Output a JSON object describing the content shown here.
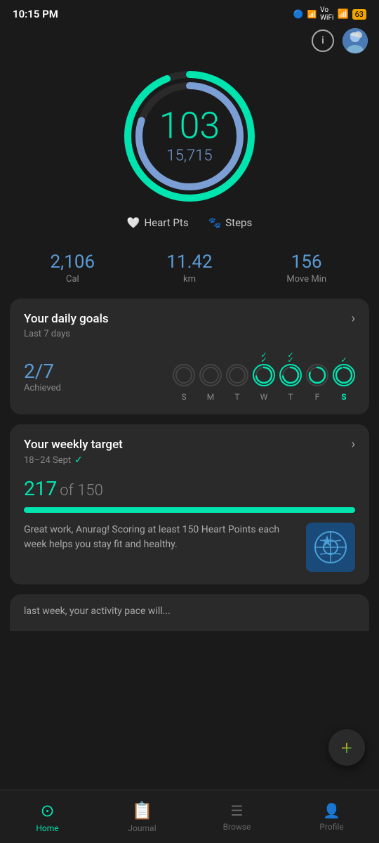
{
  "statusBar": {
    "time": "10:15 PM",
    "icons": "🔵 📶 Vo WiFi 🔋"
  },
  "header": {
    "info_label": "i",
    "avatar_emoji": "👤"
  },
  "ring": {
    "main_value": "103",
    "sub_value": "15,715",
    "outer_color": "#00e5b0",
    "inner_color": "#7b9fd4"
  },
  "legend": {
    "heart_pts_label": "Heart Pts",
    "steps_label": "Steps"
  },
  "stats": [
    {
      "value": "2,106",
      "label": "Cal"
    },
    {
      "value": "11.42",
      "label": "km"
    },
    {
      "value": "156",
      "label": "Move Min"
    }
  ],
  "daily_goals": {
    "title": "Your daily goals",
    "subtitle": "Last 7 days",
    "achieved_fraction": "2/7",
    "achieved_label": "Achieved",
    "days": [
      "S",
      "M",
      "T",
      "W",
      "T",
      "F",
      "S"
    ],
    "achieved_days": [
      3,
      4,
      5,
      6
    ]
  },
  "weekly_target": {
    "title": "Your weekly target",
    "date_range": "18–24 Sept",
    "achieved_value": "217",
    "target_value": "150",
    "of_label": "of",
    "progress_percent": 100,
    "description": "Great work, Anurag! Scoring at least 150 Heart Points each week helps you stay fit and healthy."
  },
  "bottom_teaser": {
    "text": "last week, your activity pace will..."
  },
  "nav": [
    {
      "id": "home",
      "label": "Home",
      "icon": "⊙",
      "active": true
    },
    {
      "id": "journal",
      "label": "Journal",
      "icon": "📋",
      "active": false
    },
    {
      "id": "browse",
      "label": "Browse",
      "icon": "≡",
      "active": false
    },
    {
      "id": "profile",
      "label": "Profile",
      "icon": "👤",
      "active": false
    }
  ]
}
